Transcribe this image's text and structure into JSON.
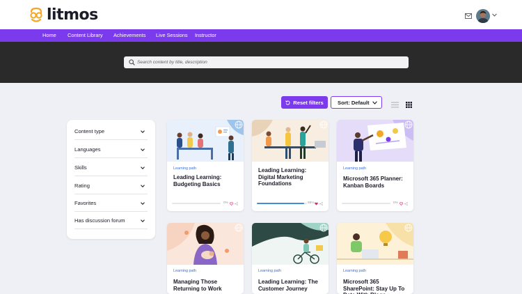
{
  "brand": {
    "name": "litmos"
  },
  "nav": {
    "items": [
      {
        "label": "Home"
      },
      {
        "label": "Content Library"
      },
      {
        "label": "Achievements"
      },
      {
        "label": "Live Sessions"
      },
      {
        "label": "Instructor"
      }
    ]
  },
  "search": {
    "placeholder": "Search content by title, description"
  },
  "toolbar": {
    "reset_label": "Reset filters",
    "sort_label": "Sort: Default"
  },
  "colors": {
    "accent": "#7c3aed",
    "hero": "#2a2a2a",
    "link": "#3b6fd6",
    "heart": "#e0245e"
  },
  "filters": [
    {
      "label": "Content type"
    },
    {
      "label": "Languages"
    },
    {
      "label": "Skills"
    },
    {
      "label": "Rating"
    },
    {
      "label": "Favorites"
    },
    {
      "label": "Has discussion forum"
    }
  ],
  "cards": [
    {
      "type": "Learning path",
      "title": "Leading Learning: Budgeting Basics",
      "progress_text": "0%",
      "progress": 0
    },
    {
      "type": "",
      "title": "Leading Learning: Digital Marketing Foundations",
      "progress_text": "95%",
      "progress": 95
    },
    {
      "type": "Learning path",
      "title": "Microsoft 365 Planner: Kanban Boards",
      "progress_text": "0%",
      "progress": 0
    },
    {
      "type": "Learning path",
      "title": "Managing Those Returning to Work",
      "progress_text": "",
      "progress": null
    },
    {
      "type": "Learning path",
      "title": "Leading Learning: The Customer Journey",
      "progress_text": "",
      "progress": null
    },
    {
      "type": "Learning path",
      "title": "Microsoft 365 SharePoint: Stay Up To Date With Blogs",
      "progress_text": "",
      "progress": null
    }
  ],
  "icons": [
    "logo-icon",
    "mail-icon",
    "avatar",
    "search-icon",
    "reset-icon",
    "chevron-down-icon",
    "list-view-icon",
    "grid-view-icon",
    "heart-icon",
    "share-icon",
    "globe-icon"
  ]
}
